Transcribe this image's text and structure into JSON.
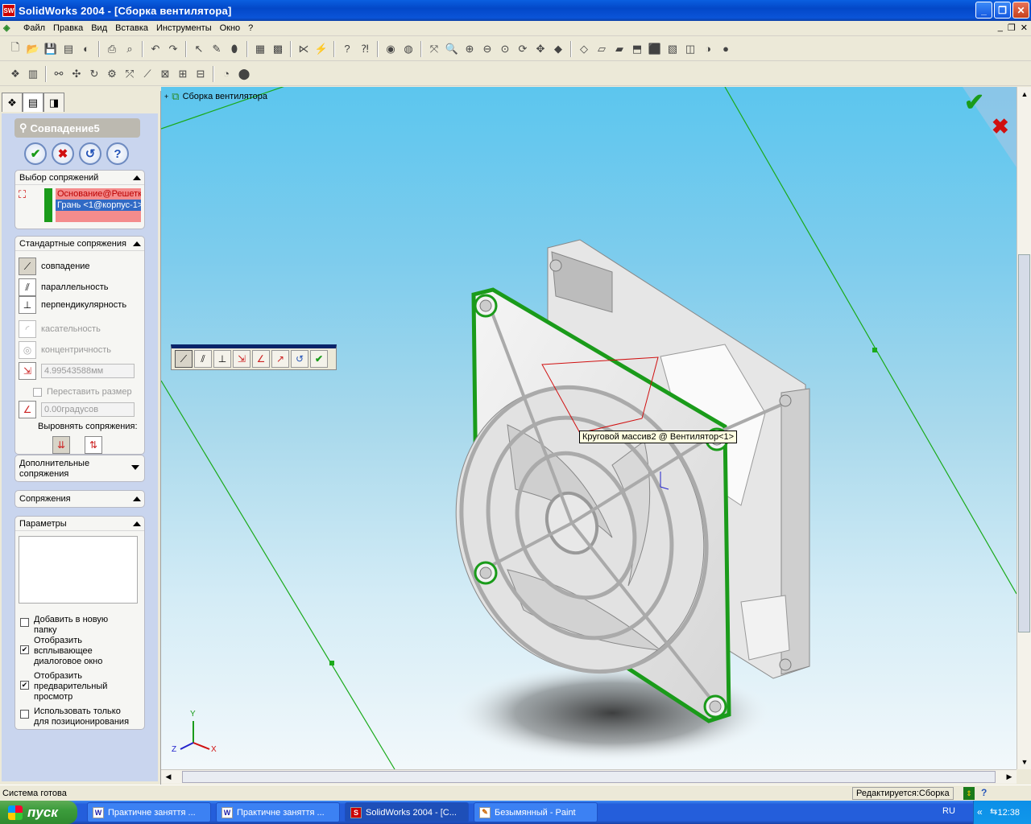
{
  "window": {
    "title": "SolidWorks 2004 - [Сборка вентилятора]",
    "app_badge": "SW"
  },
  "menu": {
    "items": [
      "Файл",
      "Правка",
      "Вид",
      "Вставка",
      "Инструменты",
      "Окно",
      "?"
    ]
  },
  "property_manager": {
    "title": "Совпадение5",
    "selections": {
      "header": "Выбор сопряжений",
      "items": [
        "Основание@Решетк",
        "Грань <1@корпус-1>"
      ]
    },
    "standard_mates": {
      "header": "Стандартные сопряжения",
      "coincident": "совпадение",
      "parallel": "параллельность",
      "perpendicular": "перпендикулярность",
      "tangent": "касательность",
      "concentric": "концентричность",
      "distance_value": "4.99543588мм",
      "flip_dimension": "Переставить размер",
      "angle_value": "0.00градусов",
      "align_label": "Выровнять сопряжения:"
    },
    "advanced_mates": {
      "header": "Дополнительные сопряжения"
    },
    "mates": {
      "header": "Сопряжения"
    },
    "options": {
      "header": "Параметры",
      "add_to_folder": "Добавить в новую папку",
      "show_popup": "Отобразить всплывающее диалоговое окно",
      "show_preview": "Отобразить предварительный просмотр",
      "positioning_only": "Использовать только для позиционирования",
      "add_to_folder_checked": false,
      "show_popup_checked": true,
      "show_preview_checked": true,
      "positioning_only_checked": false
    }
  },
  "viewport": {
    "tree_root": "Сборка вентилятора",
    "tooltip": "Круговой массив2 @ Вентилятор<1>",
    "triad": {
      "x": "X",
      "y": "Y",
      "z": "Z"
    }
  },
  "status": {
    "left": "Система готова",
    "right": "Редактируется:Сборка"
  },
  "taskbar": {
    "start": "пуск",
    "tasks": [
      "Практичне заняття ...",
      "Практичне заняття ...",
      "SolidWorks 2004 - [С...",
      "Безымянный - Paint"
    ],
    "lang": "RU",
    "clock": "12:38"
  },
  "colors": {
    "accent_green": "#1a9b1a",
    "mate_red": "#d01010",
    "title_blue": "#0a54d8"
  }
}
